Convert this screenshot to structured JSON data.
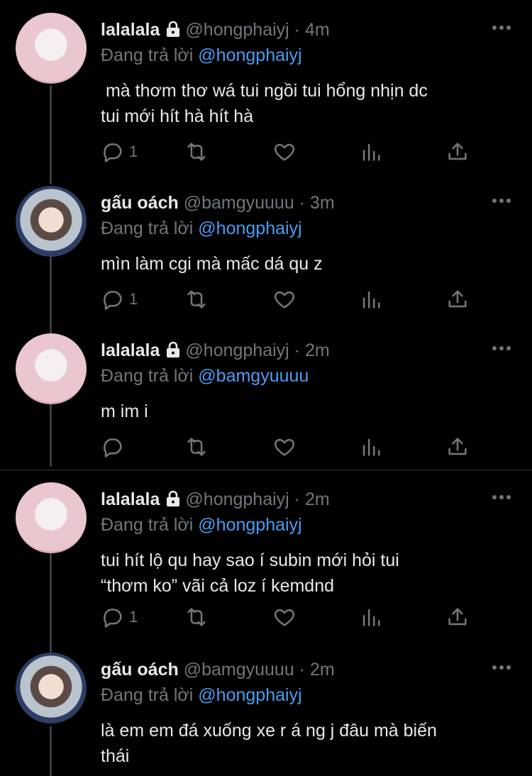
{
  "tweets": [
    {
      "name": "lalalala",
      "locked": true,
      "handle": "@hongphaiyj",
      "time": "4m",
      "reply_prefix": "Đang trả lời",
      "reply_to": "@hongphaiyj",
      "text": " mà thơm thơ wá tui ngồi tui hổng nhịn dc\ntui mới hít hà hít hà",
      "reply_count": "1",
      "avatar": "my-melody"
    },
    {
      "name": "gấu oách",
      "locked": false,
      "handle": "@bamgyuuuu",
      "time": "3m",
      "reply_prefix": "Đang trả lời",
      "reply_to": "@hongphaiyj",
      "text": "mìn làm cgi mà mấc dá qu z",
      "reply_count": "1",
      "avatar": "boy-bunny-hat"
    },
    {
      "name": "lalalala",
      "locked": true,
      "handle": "@hongphaiyj",
      "time": "2m",
      "reply_prefix": "Đang trả lời",
      "reply_to": "@bamgyuuuu",
      "text": "m im i",
      "reply_count": "",
      "avatar": "my-melody"
    },
    {
      "name": "lalalala",
      "locked": true,
      "handle": "@hongphaiyj",
      "time": "2m",
      "reply_prefix": "Đang trả lời",
      "reply_to": "@hongphaiyj",
      "text": "tui hít lộ qu hay sao í subin mới hỏi tui\n“thơm ko” vãi cả loz í kemdnd",
      "reply_count": "1",
      "avatar": "my-melody"
    },
    {
      "name": "gấu oách",
      "locked": false,
      "handle": "@bamgyuuuu",
      "time": "2m",
      "reply_prefix": "Đang trả lời",
      "reply_to": "@hongphaiyj",
      "text": "là em em đá xuống xe r á ng j đâu mà biến\nthái",
      "reply_count": "",
      "avatar": "boy-bunny-hat"
    }
  ],
  "separator": " · ",
  "icons": [
    "reply-icon",
    "retweet-icon",
    "like-icon",
    "views-icon",
    "share-icon",
    "more-icon",
    "lock-icon"
  ],
  "colors": {
    "background": "#000000",
    "text": "#e7e9ea",
    "muted": "#71767b",
    "mention": "#4a9cf0"
  }
}
